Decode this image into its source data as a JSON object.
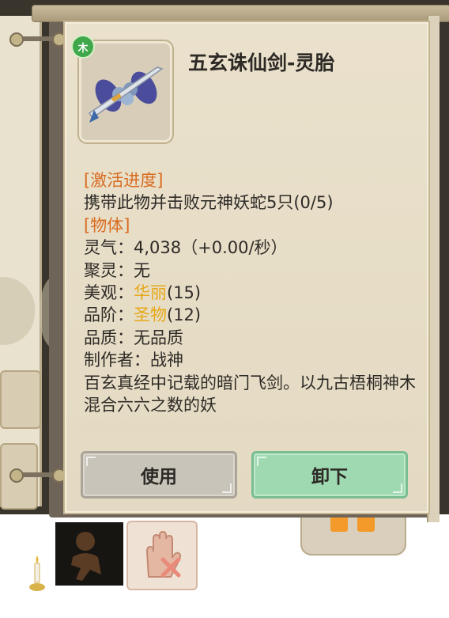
{
  "item": {
    "name": "五玄诛仙剑-灵胎",
    "element_badge": "木"
  },
  "details": {
    "activation_header": "[激活进度]",
    "activation_text": "携带此物并击败元神妖蛇5只(0/5)",
    "object_header": "[物体]",
    "lingqi_label": "灵气：",
    "lingqi_value": "4,038（+0.00/秒）",
    "juling_label": "聚灵：",
    "juling_value": "无",
    "meiguan_label": "美观：",
    "meiguan_value": "华丽",
    "meiguan_num": "(15)",
    "pinjie_label": "品阶：",
    "pinjie_value": "圣物",
    "pinjie_num": "(12)",
    "pinzhi_label": "品质：",
    "pinzhi_value": "无品质",
    "maker_label": "制作者：",
    "maker_value": "战神",
    "description": "百玄真经中记载的暗门飞剑。以九古梧桐神木混合六六之数的妖"
  },
  "buttons": {
    "use": "使用",
    "unequip": "卸下"
  },
  "colors": {
    "section_header": "#d86b1f",
    "quality_highlight": "#e6a817",
    "use_button": "#c9c4ba",
    "unequip_button": "#9fd9b2",
    "element_wood": "#3fa84a"
  }
}
